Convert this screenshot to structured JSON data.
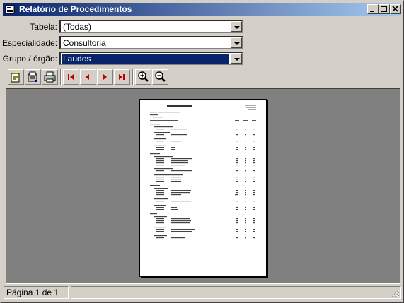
{
  "window": {
    "title": "Relatório de Procedimentos",
    "controls": {
      "minimize": "_",
      "maximize": "□",
      "close": "×"
    }
  },
  "filters": [
    {
      "label": "Tabela:",
      "value": "(Todas)"
    },
    {
      "label": "Especialidade:",
      "value": "Consultoria"
    },
    {
      "label": "Grupo / órgão:",
      "value": "Laudos"
    }
  ],
  "toolbar": {
    "buttons": [
      "open-report-icon",
      "print-setup-icon",
      "print-icon",
      "first-page-icon",
      "prev-page-icon",
      "next-page-icon",
      "last-page-icon",
      "zoom-in-icon",
      "zoom-out-icon"
    ]
  },
  "status": {
    "page_text": "Página 1 de 1"
  },
  "colors": {
    "title_start": "#0a246a",
    "title_end": "#a6caf0",
    "nav_red": "#c00000",
    "preview_bg": "#808080"
  }
}
